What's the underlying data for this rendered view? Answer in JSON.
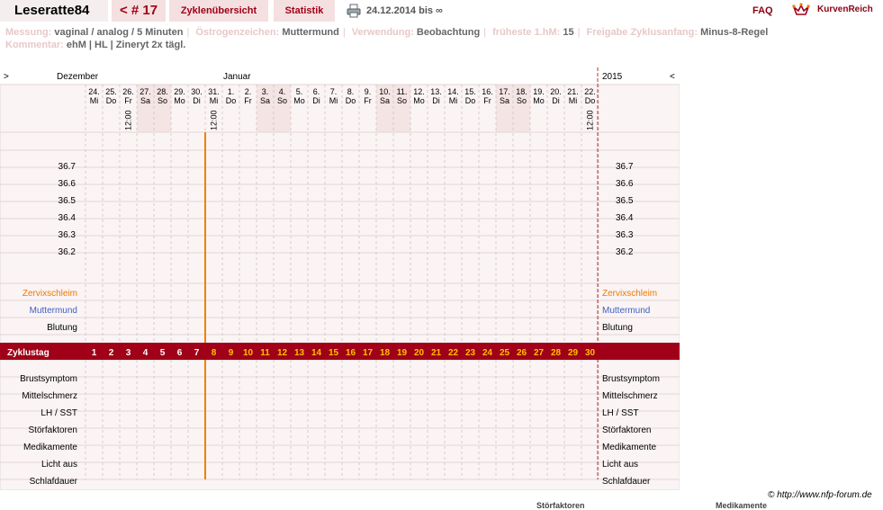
{
  "header": {
    "username": "Leseratte84",
    "cycle_nav": "< # 17",
    "nav_cycles": "Zyklenübersicht",
    "nav_stats": "Statistik",
    "date_range": "24.12.2014 bis ∞",
    "faq": "FAQ",
    "brand": "KurvenReich",
    "print_icon": "printer-icon",
    "logo_icon": "crown-icon"
  },
  "meta": {
    "row1": [
      {
        "label": "Messung:",
        "value": "vaginal / analog / 5 Minuten"
      },
      {
        "label": "Östrogenzeichen:",
        "value": "Muttermund"
      },
      {
        "label": "Verwendung:",
        "value": "Beobachtung"
      },
      {
        "label": "früheste 1.hM:",
        "value": "15"
      },
      {
        "label": "Freigabe Zyklusanfang:",
        "value": "Minus-8-Regel"
      }
    ],
    "row2": [
      {
        "label": "Kommentar:",
        "value": "ehM | HL | Zineryt 2x tägl."
      }
    ]
  },
  "chart_data": {
    "type": "table",
    "nav_prev": ">",
    "nav_next": "<",
    "month_left": "Dezember",
    "month_mid": "Januar",
    "year": "2015",
    "days": [
      {
        "d": "24.",
        "w": "Mi",
        "time": "",
        "we": false
      },
      {
        "d": "25.",
        "w": "Do",
        "time": "",
        "we": false
      },
      {
        "d": "26.",
        "w": "Fr",
        "time": "12:00",
        "we": false
      },
      {
        "d": "27.",
        "w": "Sa",
        "time": "",
        "we": true
      },
      {
        "d": "28.",
        "w": "So",
        "time": "",
        "we": true
      },
      {
        "d": "29.",
        "w": "Mo",
        "time": "",
        "we": false
      },
      {
        "d": "30.",
        "w": "Di",
        "time": "",
        "we": false
      },
      {
        "d": "31.",
        "w": "Mi",
        "time": "12:00",
        "we": false
      },
      {
        "d": "1.",
        "w": "Do",
        "time": "",
        "we": false
      },
      {
        "d": "2.",
        "w": "Fr",
        "time": "",
        "we": false
      },
      {
        "d": "3.",
        "w": "Sa",
        "time": "",
        "we": true
      },
      {
        "d": "4.",
        "w": "So",
        "time": "",
        "we": true
      },
      {
        "d": "5.",
        "w": "Mo",
        "time": "",
        "we": false
      },
      {
        "d": "6.",
        "w": "Di",
        "time": "",
        "we": false
      },
      {
        "d": "7.",
        "w": "Mi",
        "time": "",
        "we": false
      },
      {
        "d": "8.",
        "w": "Do",
        "time": "",
        "we": false
      },
      {
        "d": "9.",
        "w": "Fr",
        "time": "",
        "we": false
      },
      {
        "d": "10.",
        "w": "Sa",
        "time": "",
        "we": true
      },
      {
        "d": "11.",
        "w": "So",
        "time": "",
        "we": true
      },
      {
        "d": "12.",
        "w": "Mo",
        "time": "",
        "we": false
      },
      {
        "d": "13.",
        "w": "Di",
        "time": "",
        "we": false
      },
      {
        "d": "14.",
        "w": "Mi",
        "time": "",
        "we": false
      },
      {
        "d": "15.",
        "w": "Do",
        "time": "",
        "we": false
      },
      {
        "d": "16.",
        "w": "Fr",
        "time": "",
        "we": false
      },
      {
        "d": "17.",
        "w": "Sa",
        "time": "",
        "we": true
      },
      {
        "d": "18.",
        "w": "So",
        "time": "",
        "we": true
      },
      {
        "d": "19.",
        "w": "Mo",
        "time": "",
        "we": false
      },
      {
        "d": "20.",
        "w": "Di",
        "time": "",
        "we": false
      },
      {
        "d": "21.",
        "w": "Mi",
        "time": "",
        "we": false
      },
      {
        "d": "22.",
        "w": "Do",
        "time": "12:00",
        "we": false
      }
    ],
    "temps": [
      "36.7",
      "36.6",
      "36.5",
      "36.4",
      "36.3",
      "36.2"
    ],
    "signs": [
      {
        "label": "Zervixschleim",
        "color": "#f07800"
      },
      {
        "label": "Muttermund",
        "color": "#4060c0"
      },
      {
        "label": "Blutung",
        "color": "#000000"
      }
    ],
    "cycle_label": "Zyklustag",
    "cycle_days": [
      "1",
      "2",
      "3",
      "4",
      "5",
      "6",
      "7",
      "8",
      "9",
      "10",
      "11",
      "12",
      "13",
      "14",
      "15",
      "16",
      "17",
      "18",
      "19",
      "20",
      "21",
      "22",
      "23",
      "24",
      "25",
      "26",
      "27",
      "28",
      "29",
      "30"
    ],
    "cycle_preovu_count": 7,
    "bottom_rows": [
      "Brustsymptom",
      "Mittelschmerz",
      "LH / SST",
      "Störfaktoren",
      "Medikamente",
      "Licht aus",
      "Schlafdauer"
    ],
    "colors": {
      "accent": "#a00018",
      "marker": "#f08000",
      "cycle_num": "#ffc000",
      "weekend": "#f4e4e4"
    }
  },
  "footer": {
    "copyright": "© http://www.nfp-forum.de",
    "cut_label1": "Störfaktoren",
    "cut_label2": "Medikamente"
  }
}
